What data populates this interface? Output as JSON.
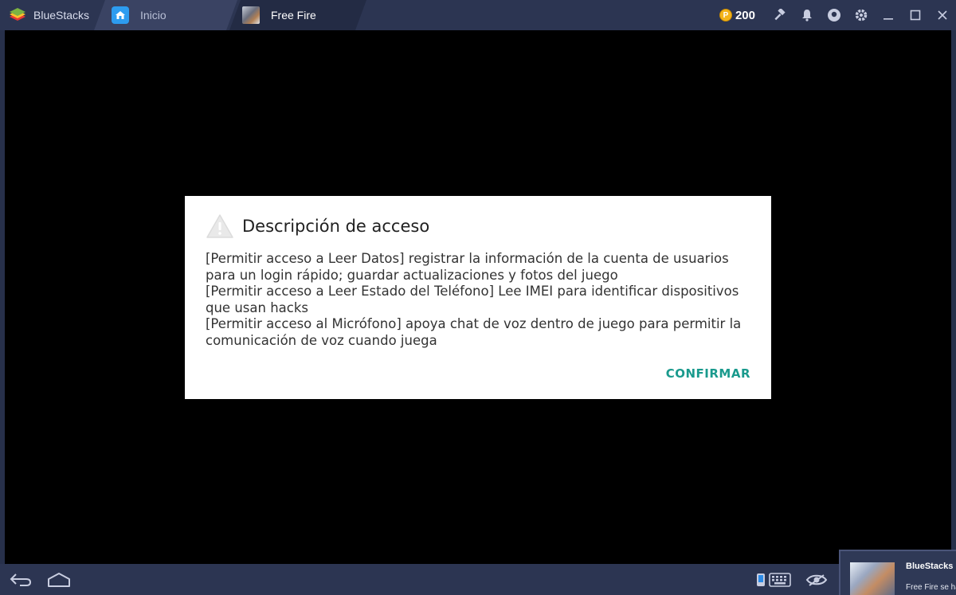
{
  "app": {
    "name": "BlueStacks"
  },
  "tabs": [
    {
      "label": "Inicio",
      "icon": "home-icon"
    },
    {
      "label": "Free Fire",
      "icon": "free-fire-app-icon"
    }
  ],
  "toolbar": {
    "coins": "200",
    "coin_symbol": "P",
    "icons": [
      "hammer-icon",
      "bell-icon",
      "account-icon",
      "gear-icon",
      "minimize-icon",
      "maximize-icon",
      "close-icon"
    ]
  },
  "dialog": {
    "title": "Descripción de acceso",
    "icon": "warning-icon",
    "paragraphs": [
      "[Permitir acceso a Leer Datos] registrar la información de la cuenta de usuarios para un login rápido; guardar actualizaciones y fotos del juego",
      "[Permitir acceso a Leer Estado del Teléfono] Lee IMEI para identificar dispositivos que usan hacks",
      "[Permitir acceso al Micrófono] apoya chat de voz dentro de juego para permitir la comunicación de voz cuando juega"
    ],
    "confirm_label": "CONFIRMAR"
  },
  "bottombar": {
    "icons": [
      "back-icon",
      "home-icon",
      "phone-icon",
      "keyboard-icon",
      "eye-icon"
    ]
  },
  "notification": {
    "title": "BlueStacks",
    "text": "Free Fire se ha"
  },
  "colors": {
    "titlebar": "#2c3552",
    "accent_button": "#1a9a8d",
    "coin": "#f3b41b",
    "tab_home_icon": "#2d9cf0"
  }
}
